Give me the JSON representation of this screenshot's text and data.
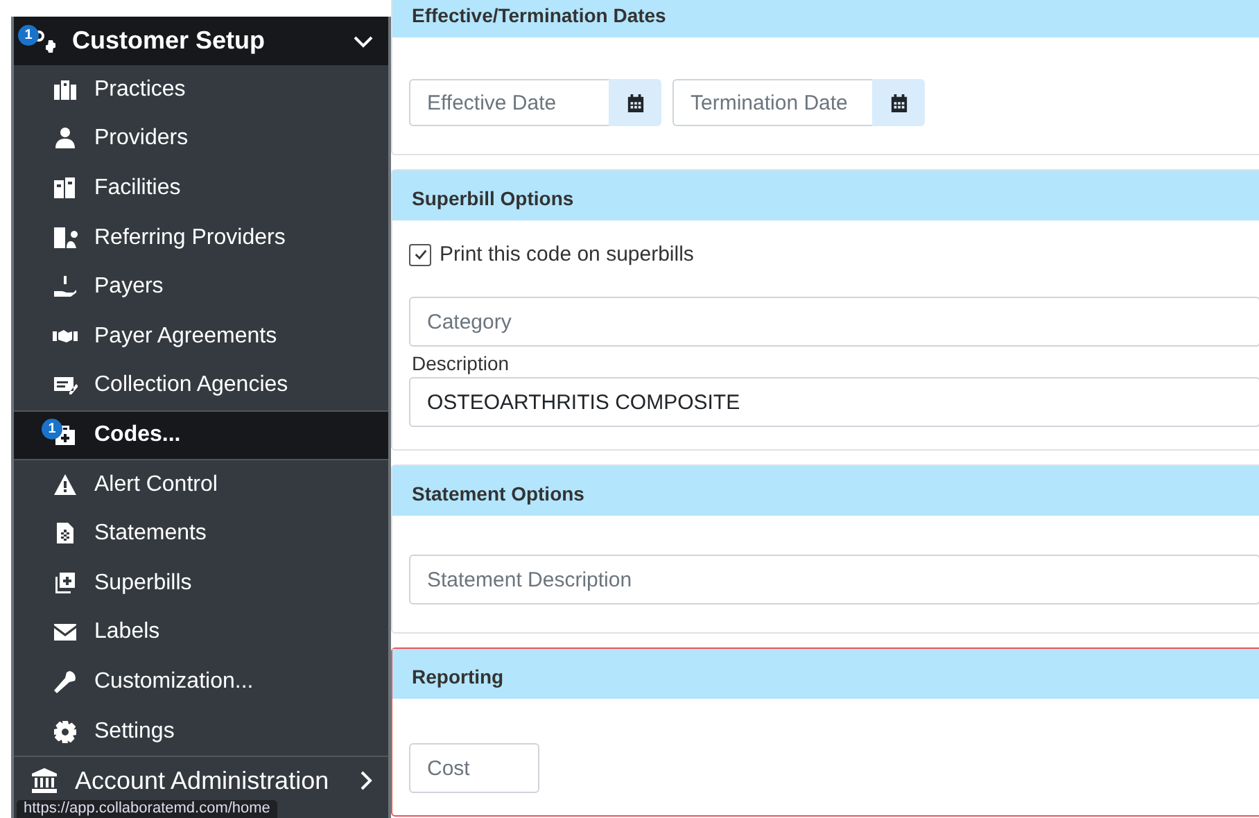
{
  "sidebar": {
    "header": {
      "label": "Customer Setup",
      "badge": "1",
      "expanded": true
    },
    "items": [
      {
        "label": "Practices",
        "selected": false
      },
      {
        "label": "Providers",
        "selected": false
      },
      {
        "label": "Facilities",
        "selected": false
      },
      {
        "label": "Referring Providers",
        "selected": false
      },
      {
        "label": "Payers",
        "selected": false
      },
      {
        "label": "Payer Agreements",
        "selected": false
      },
      {
        "label": "Collection Agencies",
        "selected": false
      },
      {
        "label": "Codes...",
        "selected": true,
        "badge": "1"
      },
      {
        "label": "Alert Control",
        "selected": false
      },
      {
        "label": "Statements",
        "selected": false
      },
      {
        "label": "Superbills",
        "selected": false
      },
      {
        "label": "Labels",
        "selected": false
      },
      {
        "label": "Customization...",
        "selected": false
      },
      {
        "label": "Settings",
        "selected": false
      }
    ],
    "footer": {
      "label": "Account Administration",
      "expanded": false
    }
  },
  "status_url": "https://app.collaboratemd.com/home",
  "sections": [
    {
      "title": "Effective/Termination Dates",
      "highlighted": false,
      "fields": [
        {
          "kind": "date",
          "placeholder": "Effective Date"
        },
        {
          "kind": "date",
          "placeholder": "Termination Date"
        }
      ]
    },
    {
      "title": "Superbill Options",
      "highlighted": false,
      "fields": [
        {
          "kind": "checkbox",
          "label": "Print this code on superbills",
          "checked": true
        },
        {
          "kind": "text",
          "placeholder": "Category"
        },
        {
          "kind": "text",
          "label": "Description",
          "value": "OSTEOARTHRITIS COMPOSITE"
        }
      ]
    },
    {
      "title": "Statement Options",
      "highlighted": false,
      "fields": [
        {
          "kind": "text",
          "placeholder": "Statement Description"
        }
      ]
    },
    {
      "title": "Reporting",
      "highlighted": true,
      "fields": [
        {
          "kind": "short",
          "placeholder": "Cost"
        }
      ]
    }
  ]
}
